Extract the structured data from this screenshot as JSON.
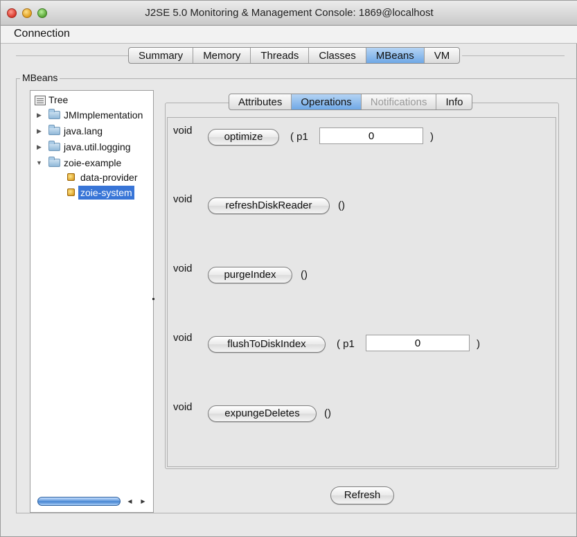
{
  "window": {
    "title": "J2SE 5.0 Monitoring & Management Console: 1869@localhost"
  },
  "menubar": {
    "items": [
      "Connection"
    ]
  },
  "main_tabs": [
    {
      "label": "Summary",
      "selected": false
    },
    {
      "label": "Memory",
      "selected": false
    },
    {
      "label": "Threads",
      "selected": false
    },
    {
      "label": "Classes",
      "selected": false
    },
    {
      "label": "MBeans",
      "selected": true
    },
    {
      "label": "VM",
      "selected": false
    }
  ],
  "mbeans": {
    "group_label": "MBeans",
    "tree": {
      "root_label": "Tree",
      "nodes": [
        {
          "label": "JMImplementation",
          "expanded": false,
          "icon": "folder-icon"
        },
        {
          "label": "java.lang",
          "expanded": false,
          "icon": "folder-icon"
        },
        {
          "label": "java.util.logging",
          "expanded": false,
          "icon": "folder-icon"
        },
        {
          "label": "zoie-example",
          "expanded": true,
          "icon": "folder-open-icon"
        },
        {
          "label": "data-provider",
          "icon": "mbean-icon"
        },
        {
          "label": "zoie-system",
          "icon": "mbean-icon",
          "selected": true
        }
      ]
    },
    "sub_tabs": [
      {
        "label": "Attributes",
        "state": "normal"
      },
      {
        "label": "Operations",
        "state": "selected"
      },
      {
        "label": "Notifications",
        "state": "disabled"
      },
      {
        "label": "Info",
        "state": "normal"
      }
    ],
    "operations": [
      {
        "return_type": "void",
        "name": "optimize",
        "params_open": "( p1",
        "params_close": ")",
        "input_value": "0"
      },
      {
        "return_type": "void",
        "name": "refreshDiskReader",
        "params": "()"
      },
      {
        "return_type": "void",
        "name": "purgeIndex",
        "params": "()"
      },
      {
        "return_type": "void",
        "name": "flushToDiskIndex",
        "params_open": "( p1",
        "params_close": ")",
        "input_value": "0"
      },
      {
        "return_type": "void",
        "name": "expungeDeletes",
        "params": "()"
      }
    ],
    "refresh_label": "Refresh"
  },
  "colors": {
    "selection": "#3875d7",
    "tab_selected": "#6fa8e6",
    "window_bg": "#e8e8e8"
  }
}
